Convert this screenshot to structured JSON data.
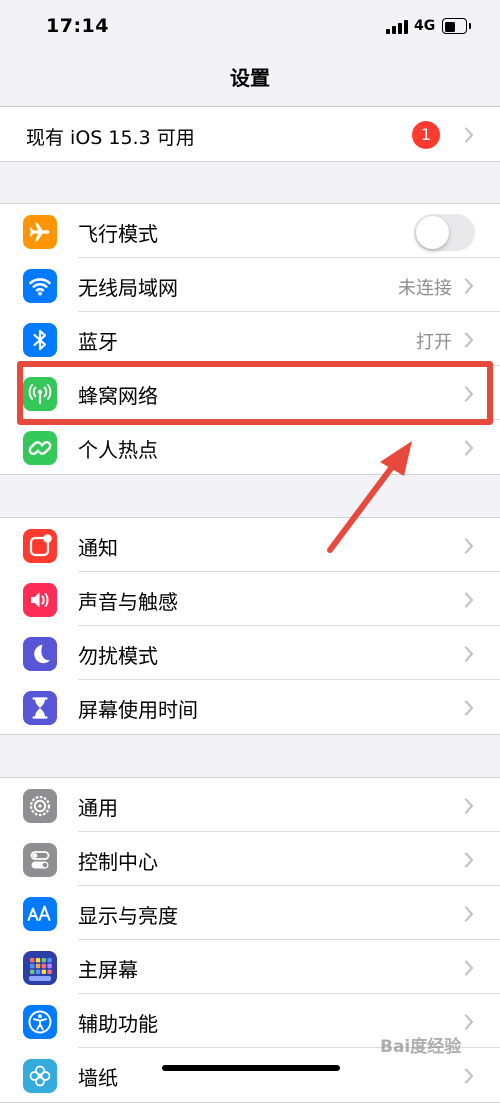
{
  "status_bar": {
    "time": "17:14",
    "network": "4G",
    "battery_level": 0.6
  },
  "nav": {
    "title": "设置"
  },
  "update_banner": {
    "label": "现有 iOS 15.3 可用",
    "badge": "1"
  },
  "connectivity": [
    {
      "label": "飞行模式",
      "icon": "airplane-icon",
      "color": "#ff9500",
      "toggle": false
    },
    {
      "label": "无线局域网",
      "icon": "wifi-icon",
      "color": "#007aff",
      "value": "未连接"
    },
    {
      "label": "蓝牙",
      "icon": "bluetooth-icon",
      "color": "#007aff",
      "value": "打开"
    },
    {
      "label": "蜂窝网络",
      "icon": "cellular-icon",
      "color": "#34c759",
      "highlighted": true
    },
    {
      "label": "个人热点",
      "icon": "hotspot-icon",
      "color": "#34c759"
    }
  ],
  "notifications": [
    {
      "label": "通知",
      "icon": "notifications-icon",
      "color": "#ff3b30"
    },
    {
      "label": "声音与触感",
      "icon": "sound-icon",
      "color": "#ff2d55"
    },
    {
      "label": "勿扰模式",
      "icon": "moon-icon",
      "color": "#5856d6"
    },
    {
      "label": "屏幕使用时间",
      "icon": "hourglass-icon",
      "color": "#5856d6"
    }
  ],
  "general": [
    {
      "label": "通用",
      "icon": "gear-icon",
      "color": "#8e8e93"
    },
    {
      "label": "控制中心",
      "icon": "control-center-icon",
      "color": "#8e8e93"
    },
    {
      "label": "显示与亮度",
      "icon": "display-icon",
      "color": "#007aff"
    },
    {
      "label": "主屏幕",
      "icon": "home-screen-icon",
      "color": "#2c3ea8"
    },
    {
      "label": "辅助功能",
      "icon": "accessibility-icon",
      "color": "#007aff"
    },
    {
      "label": "墙纸",
      "icon": "wallpaper-icon",
      "color": "#35aadc"
    }
  ],
  "watermark": "Bai度经验"
}
